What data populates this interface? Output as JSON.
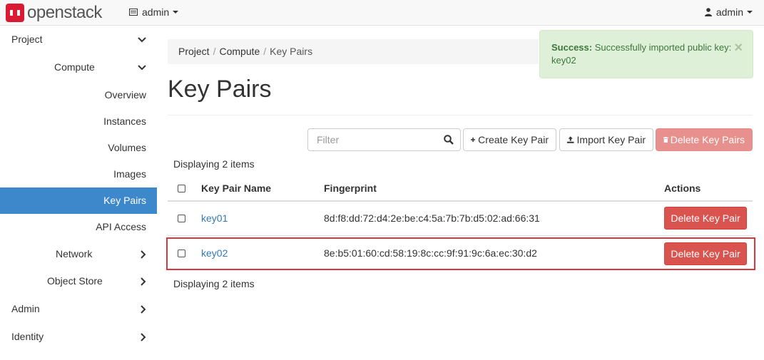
{
  "navbar": {
    "brand": "openstack",
    "project_menu": "admin",
    "user_menu": "admin"
  },
  "sidebar": {
    "project": "Project",
    "compute": "Compute",
    "items": [
      "Overview",
      "Instances",
      "Volumes",
      "Images",
      "Key Pairs",
      "API Access"
    ],
    "active": "Key Pairs",
    "network": "Network",
    "object_store": "Object Store",
    "admin": "Admin",
    "identity": "Identity"
  },
  "breadcrumb": [
    "Project",
    "Compute",
    "Key Pairs"
  ],
  "page_title": "Key Pairs",
  "alert": {
    "strong": "Success:",
    "message": "Successfully imported public key: key02",
    "close": "×"
  },
  "toolbar": {
    "filter_placeholder": "Filter",
    "create_label": "Create Key Pair",
    "import_label": "Import Key Pair",
    "delete_label": "Delete Key Pairs"
  },
  "table": {
    "summary": "Displaying 2 items",
    "columns": [
      "Key Pair Name",
      "Fingerprint",
      "Actions"
    ],
    "rows": [
      {
        "name": "key01",
        "fingerprint": "8d:f8:dd:72:d4:2e:be:c4:5a:7b:7b:d5:02:ad:66:31",
        "action": "Delete Key Pair"
      },
      {
        "name": "key02",
        "fingerprint": "8e:b5:01:60:cd:58:19:8c:cc:9f:91:9c:6a:ec:30:d2",
        "action": "Delete Key Pair"
      }
    ],
    "footer": "Displaying 2 items"
  },
  "colors": {
    "brand_red": "#da1a32",
    "sidebar_active": "#3d87cb",
    "danger": "#d9534f",
    "success_bg": "#dff0d8",
    "link": "#337ab7"
  }
}
